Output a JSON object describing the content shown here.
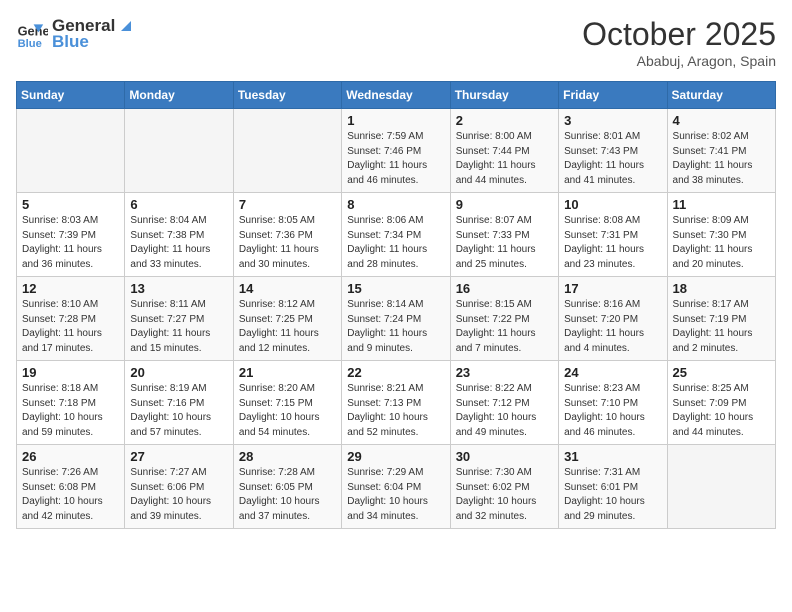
{
  "header": {
    "logo_line1": "General",
    "logo_line2": "Blue",
    "month": "October 2025",
    "location": "Ababuj, Aragon, Spain"
  },
  "days_of_week": [
    "Sunday",
    "Monday",
    "Tuesday",
    "Wednesday",
    "Thursday",
    "Friday",
    "Saturday"
  ],
  "weeks": [
    [
      {
        "day": "",
        "info": ""
      },
      {
        "day": "",
        "info": ""
      },
      {
        "day": "",
        "info": ""
      },
      {
        "day": "1",
        "info": "Sunrise: 7:59 AM\nSunset: 7:46 PM\nDaylight: 11 hours and 46 minutes."
      },
      {
        "day": "2",
        "info": "Sunrise: 8:00 AM\nSunset: 7:44 PM\nDaylight: 11 hours and 44 minutes."
      },
      {
        "day": "3",
        "info": "Sunrise: 8:01 AM\nSunset: 7:43 PM\nDaylight: 11 hours and 41 minutes."
      },
      {
        "day": "4",
        "info": "Sunrise: 8:02 AM\nSunset: 7:41 PM\nDaylight: 11 hours and 38 minutes."
      }
    ],
    [
      {
        "day": "5",
        "info": "Sunrise: 8:03 AM\nSunset: 7:39 PM\nDaylight: 11 hours and 36 minutes."
      },
      {
        "day": "6",
        "info": "Sunrise: 8:04 AM\nSunset: 7:38 PM\nDaylight: 11 hours and 33 minutes."
      },
      {
        "day": "7",
        "info": "Sunrise: 8:05 AM\nSunset: 7:36 PM\nDaylight: 11 hours and 30 minutes."
      },
      {
        "day": "8",
        "info": "Sunrise: 8:06 AM\nSunset: 7:34 PM\nDaylight: 11 hours and 28 minutes."
      },
      {
        "day": "9",
        "info": "Sunrise: 8:07 AM\nSunset: 7:33 PM\nDaylight: 11 hours and 25 minutes."
      },
      {
        "day": "10",
        "info": "Sunrise: 8:08 AM\nSunset: 7:31 PM\nDaylight: 11 hours and 23 minutes."
      },
      {
        "day": "11",
        "info": "Sunrise: 8:09 AM\nSunset: 7:30 PM\nDaylight: 11 hours and 20 minutes."
      }
    ],
    [
      {
        "day": "12",
        "info": "Sunrise: 8:10 AM\nSunset: 7:28 PM\nDaylight: 11 hours and 17 minutes."
      },
      {
        "day": "13",
        "info": "Sunrise: 8:11 AM\nSunset: 7:27 PM\nDaylight: 11 hours and 15 minutes."
      },
      {
        "day": "14",
        "info": "Sunrise: 8:12 AM\nSunset: 7:25 PM\nDaylight: 11 hours and 12 minutes."
      },
      {
        "day": "15",
        "info": "Sunrise: 8:14 AM\nSunset: 7:24 PM\nDaylight: 11 hours and 9 minutes."
      },
      {
        "day": "16",
        "info": "Sunrise: 8:15 AM\nSunset: 7:22 PM\nDaylight: 11 hours and 7 minutes."
      },
      {
        "day": "17",
        "info": "Sunrise: 8:16 AM\nSunset: 7:20 PM\nDaylight: 11 hours and 4 minutes."
      },
      {
        "day": "18",
        "info": "Sunrise: 8:17 AM\nSunset: 7:19 PM\nDaylight: 11 hours and 2 minutes."
      }
    ],
    [
      {
        "day": "19",
        "info": "Sunrise: 8:18 AM\nSunset: 7:18 PM\nDaylight: 10 hours and 59 minutes."
      },
      {
        "day": "20",
        "info": "Sunrise: 8:19 AM\nSunset: 7:16 PM\nDaylight: 10 hours and 57 minutes."
      },
      {
        "day": "21",
        "info": "Sunrise: 8:20 AM\nSunset: 7:15 PM\nDaylight: 10 hours and 54 minutes."
      },
      {
        "day": "22",
        "info": "Sunrise: 8:21 AM\nSunset: 7:13 PM\nDaylight: 10 hours and 52 minutes."
      },
      {
        "day": "23",
        "info": "Sunrise: 8:22 AM\nSunset: 7:12 PM\nDaylight: 10 hours and 49 minutes."
      },
      {
        "day": "24",
        "info": "Sunrise: 8:23 AM\nSunset: 7:10 PM\nDaylight: 10 hours and 46 minutes."
      },
      {
        "day": "25",
        "info": "Sunrise: 8:25 AM\nSunset: 7:09 PM\nDaylight: 10 hours and 44 minutes."
      }
    ],
    [
      {
        "day": "26",
        "info": "Sunrise: 7:26 AM\nSunset: 6:08 PM\nDaylight: 10 hours and 42 minutes."
      },
      {
        "day": "27",
        "info": "Sunrise: 7:27 AM\nSunset: 6:06 PM\nDaylight: 10 hours and 39 minutes."
      },
      {
        "day": "28",
        "info": "Sunrise: 7:28 AM\nSunset: 6:05 PM\nDaylight: 10 hours and 37 minutes."
      },
      {
        "day": "29",
        "info": "Sunrise: 7:29 AM\nSunset: 6:04 PM\nDaylight: 10 hours and 34 minutes."
      },
      {
        "day": "30",
        "info": "Sunrise: 7:30 AM\nSunset: 6:02 PM\nDaylight: 10 hours and 32 minutes."
      },
      {
        "day": "31",
        "info": "Sunrise: 7:31 AM\nSunset: 6:01 PM\nDaylight: 10 hours and 29 minutes."
      },
      {
        "day": "",
        "info": ""
      }
    ]
  ]
}
